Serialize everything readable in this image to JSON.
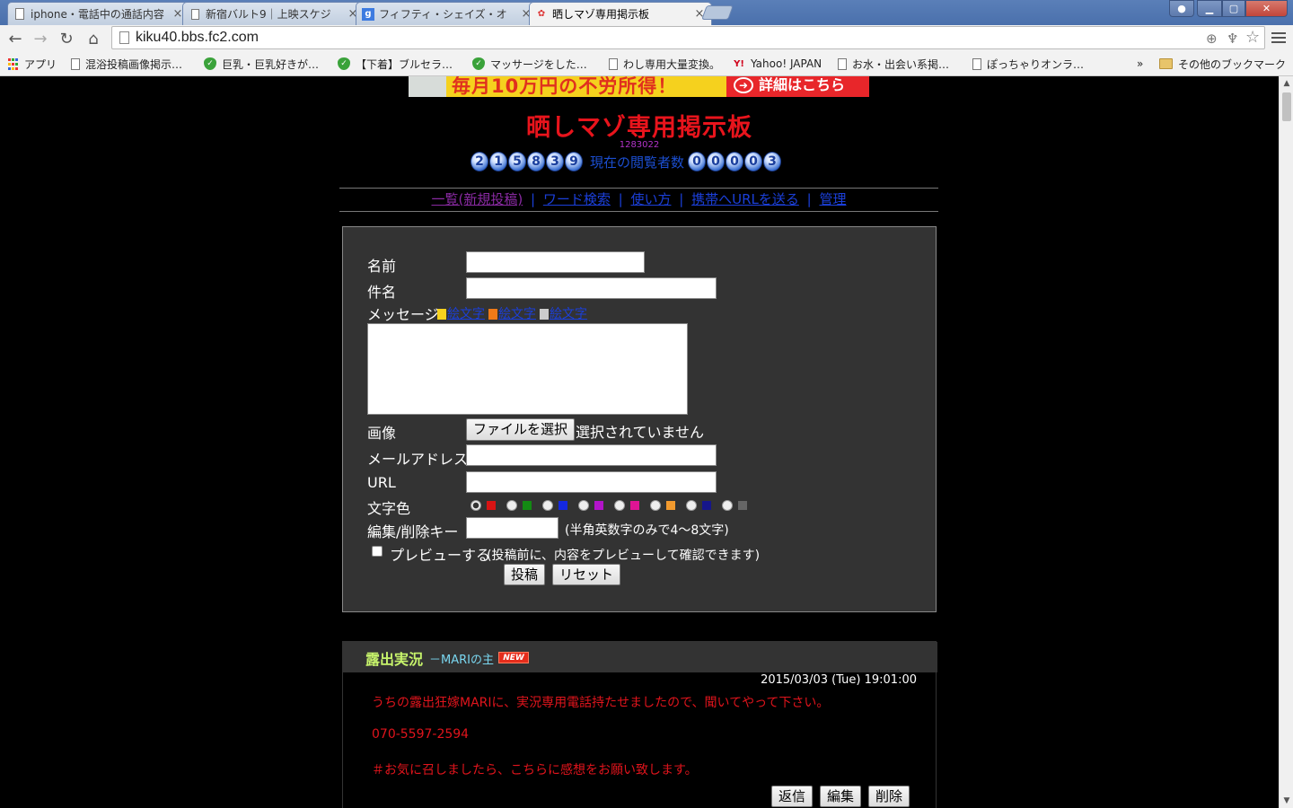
{
  "browser": {
    "tabs": [
      {
        "title": "iphone・電話中の通話内容",
        "active": false
      },
      {
        "title": "新宿バルト9｜上映スケジ",
        "active": false
      },
      {
        "title": "フィフティ・シェイズ・オ",
        "active": false
      },
      {
        "title": "晒しマゾ専用掲示板",
        "active": true
      }
    ],
    "url": "kiku40.bbs.fc2.com",
    "bookmarks": [
      {
        "label": "アプリ",
        "icon": "apps-icon"
      },
      {
        "label": "混浴投稿画像掲示…",
        "icon": "page-icon"
      },
      {
        "label": "巨乳・巨乳好きが…",
        "icon": "shield-icon"
      },
      {
        "label": "【下着】ブルセラ…",
        "icon": "shield-icon"
      },
      {
        "label": "マッサージをした…",
        "icon": "shield-icon"
      },
      {
        "label": "わし専用大量変換。",
        "icon": "page-icon"
      },
      {
        "label": "Yahoo! JAPAN",
        "icon": "yahoo-icon"
      },
      {
        "label": "お水・出会い系掲…",
        "icon": "page-icon"
      },
      {
        "label": "ぽっちゃりオンラ…",
        "icon": "page-icon"
      }
    ],
    "bookmarks_overflow": "»",
    "other_bookmarks": "その他のブックマーク"
  },
  "banner": {
    "text": "毎月10万円の不労所得！",
    "button": "詳細はこちら"
  },
  "site": {
    "title": "晒しマゾ専用掲示板",
    "small_number": "1283022",
    "total_counter": [
      "2",
      "1",
      "5",
      "8",
      "3",
      "9"
    ],
    "viewers_label": "現在の閲覧者数",
    "viewers_counter": [
      "0",
      "0",
      "0",
      "0",
      "3"
    ]
  },
  "menu": {
    "items": [
      "一覧(新規投稿)",
      "ワード検索",
      "使い方",
      "携帯へURLを送る",
      "管理"
    ],
    "separator": "|"
  },
  "form": {
    "name_label": "名前",
    "subject_label": "件名",
    "message_label": "メッセージ",
    "emoji_links": [
      "絵文字",
      "絵文字",
      "絵文字"
    ],
    "image_label": "画像",
    "file_button": "ファイルを選択",
    "file_status": "選択されていません",
    "email_label": "メールアドレス",
    "url_label": "URL",
    "color_label": "文字色",
    "colors": [
      "#d81414",
      "#138a13",
      "#1428e0",
      "#b314c9",
      "#e01494",
      "#f29a2e",
      "#16168a",
      "#666666"
    ],
    "selected_color_index": 0,
    "key_label": "編集/削除キー",
    "key_hint": "(半角英数字のみで4～8文字)",
    "preview_label": "プレビューする",
    "preview_hint": "(投稿前に、内容をプレビューして確認できます)",
    "submit": "投稿",
    "reset": "リセット"
  },
  "post": {
    "subject": "露出実況",
    "author": "－MARIの主",
    "badge": "NEW",
    "date": "2015/03/03 (Tue) 19:01:00",
    "lines": [
      "うちの露出狂嫁MARIに、実況専用電話持たせましたので、聞いてやって下さい。",
      "070-5597-2594",
      "＃お気に召しましたら、こちらに感想をお願い致します。"
    ],
    "reply": "返信",
    "edit": "編集",
    "delete": "削除"
  }
}
